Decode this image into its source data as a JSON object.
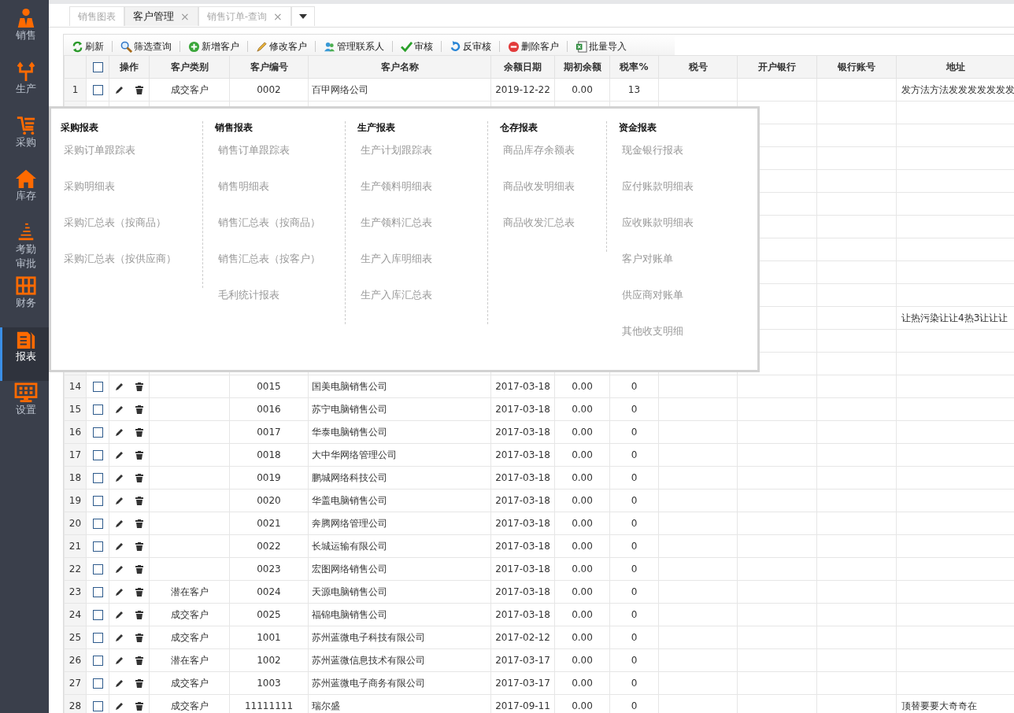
{
  "sidebar": {
    "items": [
      {
        "label": "销售",
        "selected": false
      },
      {
        "label": "生产",
        "selected": false
      },
      {
        "label": "采购",
        "selected": false
      },
      {
        "label": "库存",
        "selected": false
      },
      {
        "label": "考勤审批",
        "selected": false
      },
      {
        "label": "财务",
        "selected": false
      },
      {
        "label": "报表",
        "selected": true
      },
      {
        "label": "设置",
        "selected": false
      }
    ]
  },
  "tabs": [
    {
      "label": "销售图表",
      "selected": false
    },
    {
      "label": "客户管理",
      "selected": true,
      "close": "×"
    },
    {
      "label": "销售订单-查询",
      "selected": false,
      "close": "×"
    }
  ],
  "toolbar": [
    "刷新",
    "筛选查询",
    "新增客户",
    "修改客户",
    "管理联系人",
    "审核",
    "反审核",
    "删除客户",
    "批量导入"
  ],
  "table": {
    "select_all_checked": false,
    "columns": [
      "操作",
      "客户类别",
      "客户编号",
      "客户名称",
      "余额日期",
      "期初余额",
      "税率%",
      "税号",
      "开户银行",
      "银行账号",
      "地址"
    ],
    "rows": [
      {
        "no": "1",
        "checked": false,
        "category": "成交客户",
        "code": "0002",
        "name": "百甲网络公司",
        "date": "2019-12-22",
        "balance": "0.00",
        "tax_rate": "13",
        "address": "发方法方法发发发发发发发"
      },
      {},
      {},
      {},
      {},
      {},
      {},
      {},
      {},
      {},
      {
        "address": "让热污染让让4热3让让让"
      },
      {},
      {},
      {
        "no": "14",
        "checked": false,
        "code": "0015",
        "name": "国美电脑销售公司",
        "date": "2017-03-18",
        "balance": "0.00",
        "tax_rate": "0"
      },
      {
        "no": "15",
        "checked": false,
        "code": "0016",
        "name": "苏宁电脑销售公司",
        "date": "2017-03-18",
        "balance": "0.00",
        "tax_rate": "0"
      },
      {
        "no": "16",
        "checked": false,
        "code": "0017",
        "name": "华泰电脑销售公司",
        "date": "2017-03-18",
        "balance": "0.00",
        "tax_rate": "0"
      },
      {
        "no": "17",
        "checked": false,
        "code": "0018",
        "name": "大中华网络管理公司",
        "date": "2017-03-18",
        "balance": "0.00",
        "tax_rate": "0"
      },
      {
        "no": "18",
        "checked": false,
        "code": "0019",
        "name": "鹏城网络科技公司",
        "date": "2017-03-18",
        "balance": "0.00",
        "tax_rate": "0"
      },
      {
        "no": "19",
        "checked": false,
        "code": "0020",
        "name": "华盖电脑销售公司",
        "date": "2017-03-18",
        "balance": "0.00",
        "tax_rate": "0"
      },
      {
        "no": "20",
        "checked": false,
        "code": "0021",
        "name": "奔腾网络管理公司",
        "date": "2017-03-18",
        "balance": "0.00",
        "tax_rate": "0"
      },
      {
        "no": "21",
        "checked": false,
        "code": "0022",
        "name": "长城运输有限公司",
        "date": "2017-03-18",
        "balance": "0.00",
        "tax_rate": "0"
      },
      {
        "no": "22",
        "checked": false,
        "code": "0023",
        "name": "宏图网络销售公司",
        "date": "2017-03-18",
        "balance": "0.00",
        "tax_rate": "0"
      },
      {
        "no": "23",
        "checked": false,
        "category": "潜在客户",
        "code": "0024",
        "name": "天源电脑销售公司",
        "date": "2017-03-18",
        "balance": "0.00",
        "tax_rate": "0"
      },
      {
        "no": "24",
        "checked": false,
        "category": "成交客户",
        "code": "0025",
        "name": "福锦电脑销售公司",
        "date": "2017-03-18",
        "balance": "0.00",
        "tax_rate": "0"
      },
      {
        "no": "25",
        "checked": false,
        "category": "成交客户",
        "code": "1001",
        "name": "苏州蓝微电子科技有限公司",
        "date": "2017-02-12",
        "balance": "0.00",
        "tax_rate": "0"
      },
      {
        "no": "26",
        "checked": false,
        "category": "潜在客户",
        "code": "1002",
        "name": "苏州蓝微信息技术有限公司",
        "date": "2017-03-17",
        "balance": "0.00",
        "tax_rate": "0"
      },
      {
        "no": "27",
        "checked": false,
        "category": "成交客户",
        "code": "1003",
        "name": "苏州蓝微电子商务有限公司",
        "date": "2017-03-17",
        "balance": "0.00",
        "tax_rate": "0"
      },
      {
        "no": "28",
        "checked": false,
        "category": "成交客户",
        "code": "11111111",
        "name": "瑞尔盛",
        "date": "2017-09-11",
        "balance": "0.00",
        "tax_rate": "0",
        "address": "顶替要要大奇奇在"
      }
    ]
  },
  "report_menu": {
    "groups": [
      {
        "title": "采购报表",
        "items": [
          "采购订单跟踪表",
          "采购明细表",
          "采购汇总表（按商品）",
          "采购汇总表（按供应商）"
        ]
      },
      {
        "title": "销售报表",
        "items": [
          "销售订单跟踪表",
          "销售明细表",
          "销售汇总表（按商品）",
          "销售汇总表（按客户）",
          "毛利统计报表"
        ]
      },
      {
        "title": "生产报表",
        "items": [
          "生产计划跟踪表",
          "生产领料明细表",
          "生产领料汇总表",
          "生产入库明细表",
          "生产入库汇总表"
        ]
      },
      {
        "title": "仓存报表",
        "items": [
          "商品库存余额表",
          "商品收发明细表",
          "商品收发汇总表"
        ]
      },
      {
        "title": "资金报表",
        "items": [
          "现金银行报表",
          "应付账款明细表",
          "应收账款明细表",
          "客户对账单",
          "供应商对账单",
          "其他收支明细"
        ]
      }
    ]
  }
}
